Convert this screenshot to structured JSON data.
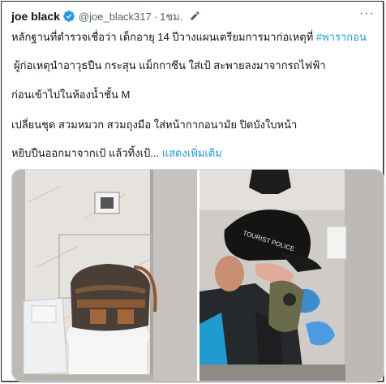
{
  "tweet": {
    "author_name": "joe black",
    "author_handle": "@joe_black317",
    "separator": "·",
    "time": "1ชม.",
    "more_label": "···",
    "line1": "หลักฐานที่ตำรวจเชื่อว่า เด็กอายุ 14 ปีวางแผนเตรียมการมาก่อเหตุที่ ",
    "hashtag": "#พารากอน",
    "line2": "ผู้ก่อเหตุนำอาวุธปืน กระสุน แม็กกาซีน ใส่เป้ สะพายลงมาจากรถไฟฟ้า",
    "line3": "ก่อนเข้าไปในห้องน้ำชั้น M",
    "line4": "เปลี่ยนชุด สวมหมวก สวมถุงมือ ใส่หน้ากากอนามัย ปิดบังใบหน้า",
    "line5": "หยิบปืนออกมาจากเป้ แล้วทิ้งเป้... ",
    "show_more": "แสดงเพิ่มเติม"
  },
  "media": {
    "left_image": "toilet-stall-with-backpack-photo",
    "right_image": "officer-in-cap-inspecting-stall-photo",
    "cap_text": "TOURIST POLICE"
  },
  "colors": {
    "accent": "#1d9bf0",
    "text": "#0f1419",
    "muted": "#536471"
  }
}
